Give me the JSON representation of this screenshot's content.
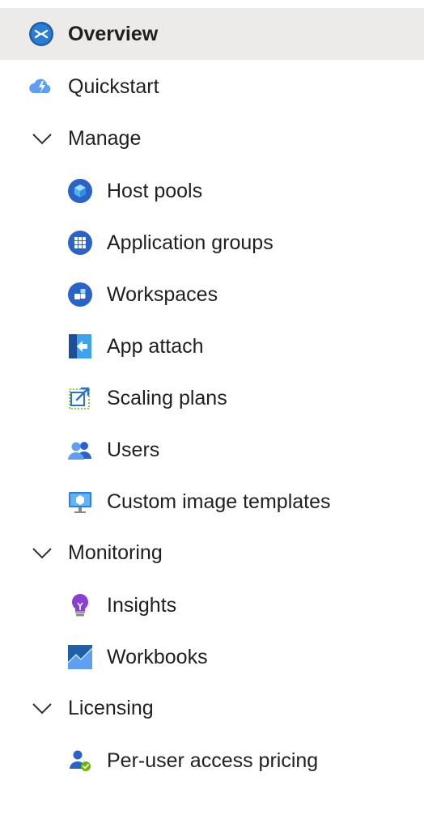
{
  "nav": {
    "overview": {
      "label": "Overview",
      "icon": "remote-desktop-icon"
    },
    "quickstart": {
      "label": "Quickstart",
      "icon": "cloud-lightning-icon"
    },
    "manage": {
      "label": "Manage",
      "items": {
        "host_pools": "Host pools",
        "application_groups": "Application groups",
        "workspaces": "Workspaces",
        "app_attach": "App attach",
        "scaling_plans": "Scaling plans",
        "users": "Users",
        "custom_image_templates": "Custom image templates"
      }
    },
    "monitoring": {
      "label": "Monitoring",
      "items": {
        "insights": "Insights",
        "workbooks": "Workbooks"
      }
    },
    "licensing": {
      "label": "Licensing",
      "items": {
        "per_user_access_pricing": "Per-user access pricing"
      }
    }
  },
  "colors": {
    "selected_background": "#edebe9",
    "azure_blue": "#0078d4",
    "text": "#201f1e"
  }
}
